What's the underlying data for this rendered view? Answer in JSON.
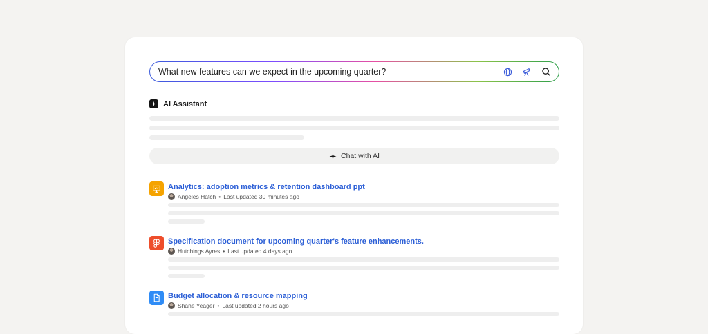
{
  "search": {
    "query": "What new features can we expect in the upcoming quarter?",
    "icons": [
      "globe-icon",
      "telescope-icon",
      "search-icon"
    ]
  },
  "assistant": {
    "title": "AI Assistant",
    "chat_label": "Chat with AI"
  },
  "results": [
    {
      "title": "Analytics: adoption metrics & retention dashboard ppt",
      "author": "Angeles Hatch",
      "updated": "Last updated 30 minutes ago",
      "icon": "presentation-icon",
      "color": "#f5a300"
    },
    {
      "title": "Specification document for upcoming quarter's feature enhancements.",
      "author": "Hutchings Ayres",
      "updated": "Last updated 4 days ago",
      "icon": "figma-icon",
      "color": "#ee4e2b"
    },
    {
      "title": "Budget allocation & resource mapping",
      "author": "Shane Yeager",
      "updated": "Last updated 2 hours ago",
      "icon": "document-icon",
      "color": "#2f8cf6"
    }
  ],
  "colors": {
    "link": "#2c5fd6",
    "background": "#f4f3f1",
    "card": "#ffffff"
  }
}
